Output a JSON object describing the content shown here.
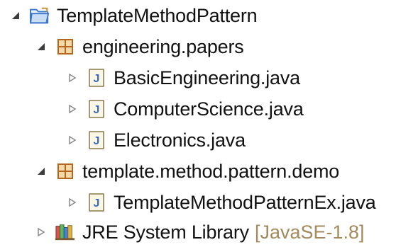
{
  "colors": {
    "text": "#111111",
    "decoration": "#a4895c",
    "folder": "#3b75c9",
    "package": "#b5651d",
    "java_file": "#5a7fb8",
    "library": "#7a5c2e",
    "twisty": "#8a8a8a"
  },
  "tree": {
    "project": {
      "label": "TemplateMethodPattern",
      "icon": "project-folder-icon",
      "expanded": true
    },
    "packages": [
      {
        "label": "engineering.papers",
        "icon": "package-icon",
        "expanded": true,
        "files": [
          {
            "label": "BasicEngineering.java",
            "icon": "java-file-icon",
            "expanded": false
          },
          {
            "label": "ComputerScience.java",
            "icon": "java-file-icon",
            "expanded": false
          },
          {
            "label": "Electronics.java",
            "icon": "java-file-icon",
            "expanded": false
          }
        ]
      },
      {
        "label": "template.method.pattern.demo",
        "icon": "package-icon",
        "expanded": true,
        "files": [
          {
            "label": "TemplateMethodPatternEx.java",
            "icon": "java-file-icon",
            "expanded": false
          }
        ]
      }
    ],
    "library": {
      "label": "JRE System Library",
      "decoration": "[JavaSE-1.8]",
      "icon": "library-icon",
      "expanded": false
    }
  }
}
